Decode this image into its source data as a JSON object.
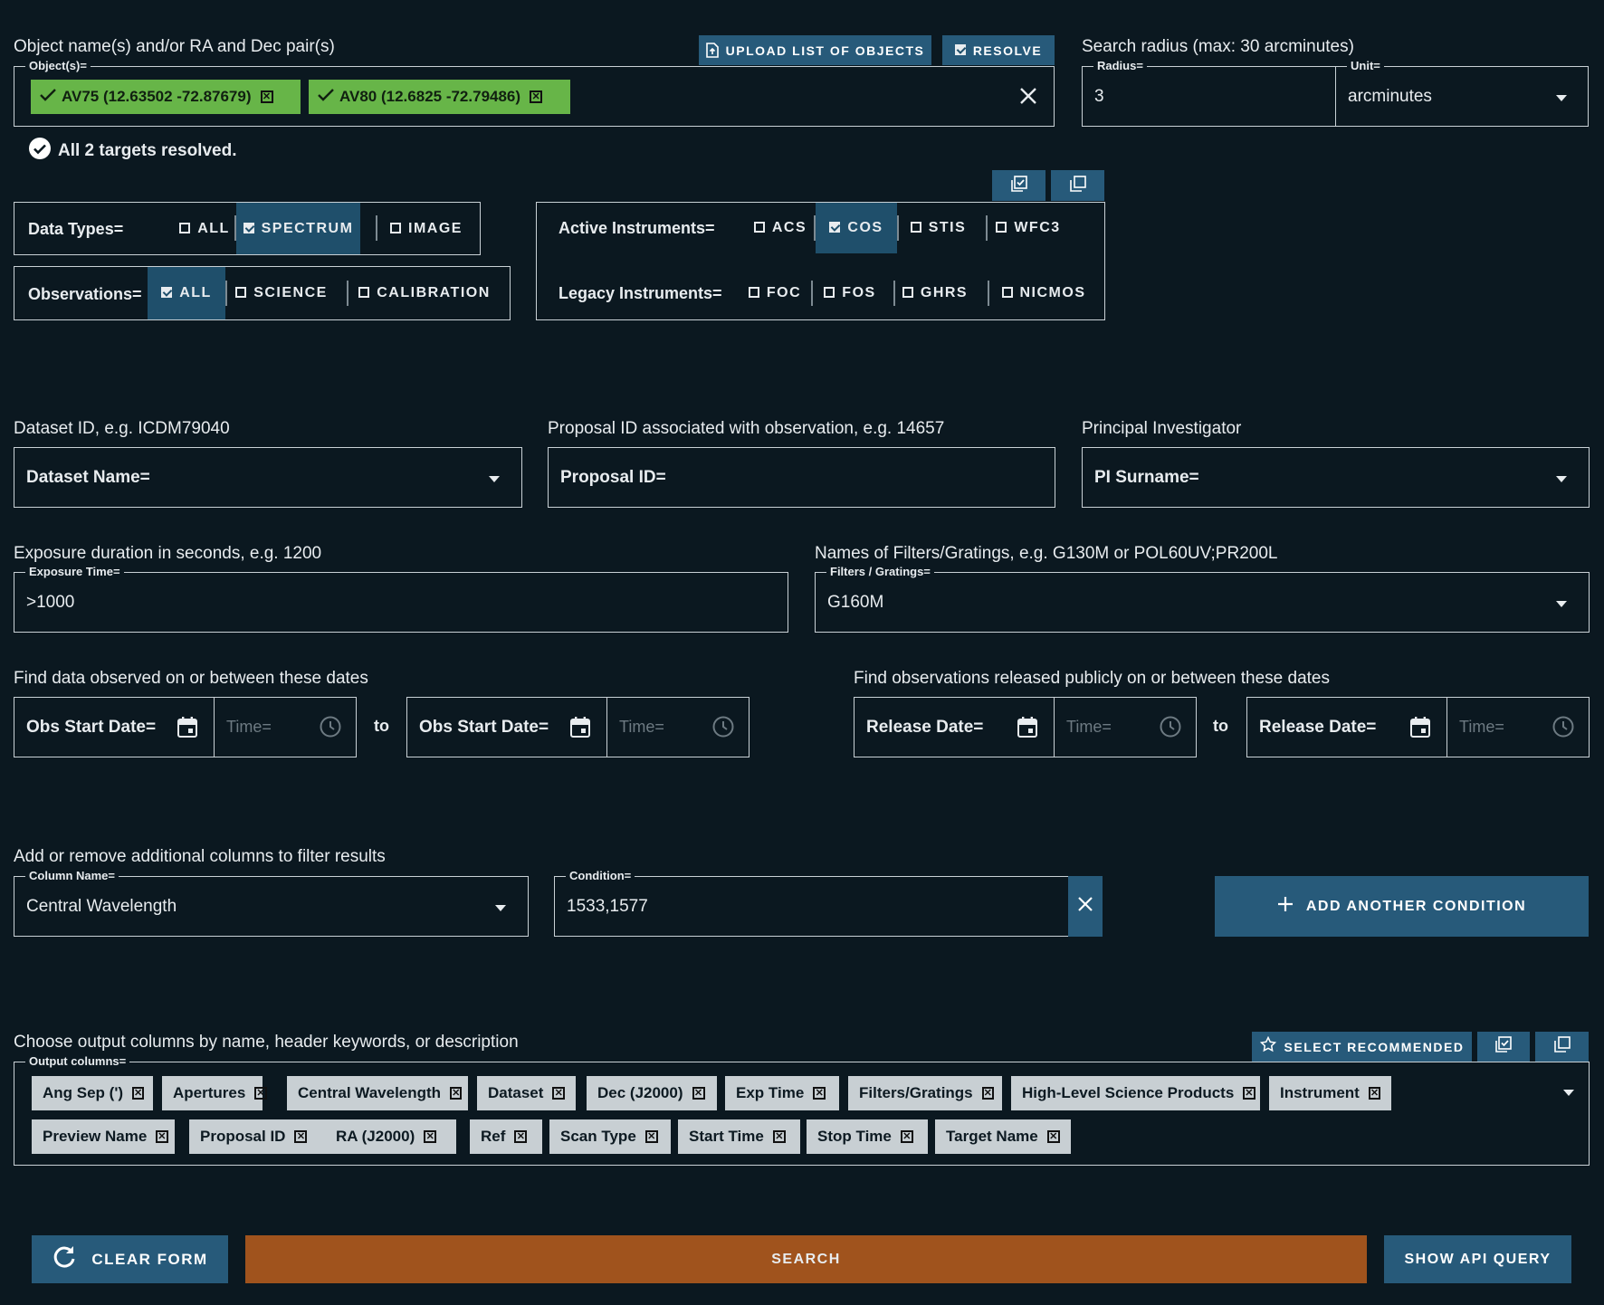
{
  "objects": {
    "heading": "Object name(s) and/or RA and Dec pair(s)",
    "legend": "Object(s)=",
    "upload_label": "UPLOAD LIST OF OBJECTS",
    "resolve_label": "RESOLVE",
    "chips": [
      "AV75 (12.63502 -72.87679)",
      "AV80 (12.6825 -72.79486)"
    ],
    "status": "All 2 targets resolved."
  },
  "radius": {
    "heading": "Search radius (max: 30 arcminutes)",
    "radius_legend": "Radius=",
    "radius_value": "3",
    "unit_legend": "Unit=",
    "unit_value": "arcminutes"
  },
  "data_types": {
    "label": "Data Types=",
    "options": [
      {
        "label": "ALL",
        "checked": false
      },
      {
        "label": "SPECTRUM",
        "checked": true
      },
      {
        "label": "IMAGE",
        "checked": false
      }
    ]
  },
  "observations": {
    "label": "Observations=",
    "options": [
      {
        "label": "ALL",
        "checked": true
      },
      {
        "label": "SCIENCE",
        "checked": false
      },
      {
        "label": "CALIBRATION",
        "checked": false
      }
    ]
  },
  "instruments": {
    "active_label": "Active Instruments=",
    "active": [
      {
        "label": "ACS",
        "checked": false
      },
      {
        "label": "COS",
        "checked": true
      },
      {
        "label": "STIS",
        "checked": false
      },
      {
        "label": "WFC3",
        "checked": false
      }
    ],
    "legacy_label": "Legacy Instruments=",
    "legacy": [
      {
        "label": "FOC",
        "checked": false
      },
      {
        "label": "FOS",
        "checked": false
      },
      {
        "label": "GHRS",
        "checked": false
      },
      {
        "label": "NICMOS",
        "checked": false
      }
    ]
  },
  "dataset": {
    "heading": "Dataset ID, e.g. ICDM79040",
    "placeholder": "Dataset Name="
  },
  "proposal": {
    "heading": "Proposal ID associated with observation, e.g. 14657",
    "placeholder": "Proposal ID="
  },
  "pi": {
    "heading": "Principal Investigator",
    "placeholder": "PI Surname="
  },
  "exposure": {
    "heading": "Exposure duration in seconds, e.g. 1200",
    "legend": "Exposure Time=",
    "value": ">1000"
  },
  "filters": {
    "heading": "Names of Filters/Gratings, e.g. G130M or POL60UV;PR200L",
    "legend": "Filters / Gratings=",
    "value": "G160M"
  },
  "obs_dates": {
    "heading": "Find data observed on or between these dates",
    "start_label": "Obs Start Date=",
    "end_label": "Obs Start Date=",
    "time_placeholder": "Time=",
    "to": "to"
  },
  "release_dates": {
    "heading": "Find observations released publicly on or between these dates",
    "start_label": "Release Date=",
    "end_label": "Release Date=",
    "time_placeholder": "Time=",
    "to": "to"
  },
  "conditions": {
    "heading": "Add or remove additional columns to filter results",
    "column_legend": "Column Name=",
    "column_value": "Central Wavelength",
    "condition_legend": "Condition=",
    "condition_value": "1533,1577",
    "add_label": "ADD ANOTHER CONDITION"
  },
  "output": {
    "heading": "Choose output columns by name, header keywords, or description",
    "legend": "Output columns=",
    "select_recommended": "SELECT RECOMMENDED",
    "row1": [
      "Ang Sep (')",
      "Apertures",
      "Central Wavelength",
      "Dataset",
      "Dec (J2000)",
      "Exp Time",
      "Filters/Gratings",
      "High-Level Science Products",
      "Instrument"
    ],
    "row2": [
      "Preview Name",
      "Proposal ID",
      "RA (J2000)",
      "Ref",
      "Scan Type",
      "Start Time",
      "Stop Time",
      "Target Name"
    ]
  },
  "actions": {
    "clear": "CLEAR FORM",
    "search": "SEARCH",
    "api": "SHOW API QUERY"
  },
  "colors": {
    "background": "#0b1820",
    "accent_blue": "#275a7a",
    "selected_blue": "#1f4f6b",
    "resolved_green": "#67b548",
    "search_orange": "#a0531d",
    "chip_gray": "#c8cfd3"
  }
}
